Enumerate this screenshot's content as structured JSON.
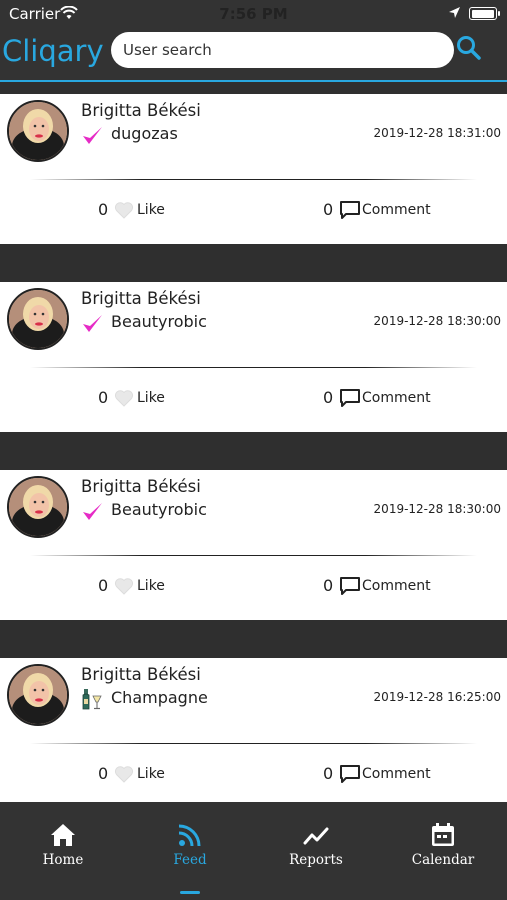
{
  "status_bar": {
    "carrier": "Carrier",
    "time": "7:56 PM"
  },
  "header": {
    "brand": "Cliqary",
    "search_placeholder": "User search"
  },
  "posts": [
    {
      "name": "Brigitta Békési",
      "activity": "dugozas",
      "activity_icon": "checkmark-icon",
      "time": "2019-12-28 18:31:00",
      "likes": "0",
      "like_label": "Like",
      "comments": "0",
      "comment_label": "Comment"
    },
    {
      "name": "Brigitta Békési",
      "activity": "Beautyrobic",
      "activity_icon": "checkmark-icon",
      "time": "2019-12-28 18:30:00",
      "likes": "0",
      "like_label": "Like",
      "comments": "0",
      "comment_label": "Comment"
    },
    {
      "name": "Brigitta Békési",
      "activity": "Beautyrobic",
      "activity_icon": "checkmark-icon",
      "time": "2019-12-28 18:30:00",
      "likes": "0",
      "like_label": "Like",
      "comments": "0",
      "comment_label": "Comment"
    },
    {
      "name": "Brigitta Békési",
      "activity": "Champagne",
      "activity_icon": "champagne-icon",
      "time": "2019-12-28 16:25:00",
      "likes": "0",
      "like_label": "Like",
      "comments": "0",
      "comment_label": "Comment"
    }
  ],
  "tabs": [
    {
      "label": "Home",
      "icon": "home-icon",
      "active": false
    },
    {
      "label": "Feed",
      "icon": "feed-icon",
      "active": true
    },
    {
      "label": "Reports",
      "icon": "reports-icon",
      "active": false
    },
    {
      "label": "Calendar",
      "icon": "calendar-icon",
      "active": false
    }
  ],
  "colors": {
    "accent": "#29a8e0",
    "check": "#e62bc6",
    "background": "#2f2f2f"
  }
}
